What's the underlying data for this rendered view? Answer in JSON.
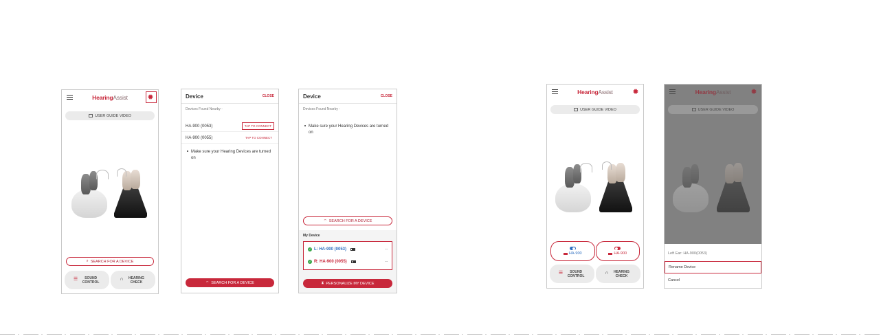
{
  "colors": {
    "brand": "#c8283b",
    "connected_blue": "#2f6fc0",
    "check_green": "#3aa84a"
  },
  "logo": {
    "part1": "Hearing",
    "part2": "Assist"
  },
  "home": {
    "user_guide_label": "USER GUIDE VIDEO",
    "search_label": "SEARCH FOR A DEVICE",
    "sound_control_label": "SOUND CONTROL",
    "hearing_check_label": "HEARING CHECK"
  },
  "device_screen": {
    "title": "Device",
    "close_label": "CLOSE",
    "found_label": "Devices Found Nearby",
    "devices": [
      {
        "name": "HA-900 (0053)",
        "action": "TAP TO CONNECT"
      },
      {
        "name": "HA-900 (0055)",
        "action": "TAP TO CONNECT"
      }
    ],
    "note": "Make sure your Hearing Devices are turned on",
    "search_label": "SEARCH FOR A DEVICE"
  },
  "my_device_screen": {
    "title": "Device",
    "close_label": "CLOSE",
    "found_label": "Devices Found Nearby",
    "note": "Make sure your Hearing Devices are turned on",
    "search_label": "SEARCH FOR A DEVICE",
    "my_device_label": "My Device",
    "left_device": "L: HA-900 (0053)",
    "right_device": "R: HA-900 (0055)",
    "dash": "--",
    "personalize_label": "PERSONALIZE MY DEVICE"
  },
  "connected_screen": {
    "left_label": "HA-900",
    "right_label": "HA-900",
    "user_guide_label": "USER GUIDE VIDEO",
    "sound_control_label": "SOUND CONTROL",
    "hearing_check_label": "HEARING CHECK"
  },
  "sheet_screen": {
    "user_guide_label": "USER GUIDE VIDEO",
    "title": "Left Ear: HA-900(0053)",
    "rename_label": "Rename Device",
    "cancel_label": "Cancel"
  },
  "icons": [
    "menu-icon",
    "gear-icon",
    "film-icon",
    "search-icon",
    "wifi-icon",
    "sliders-icon",
    "headphones-icon",
    "check-icon",
    "battery-icon",
    "toggle-icon"
  ]
}
